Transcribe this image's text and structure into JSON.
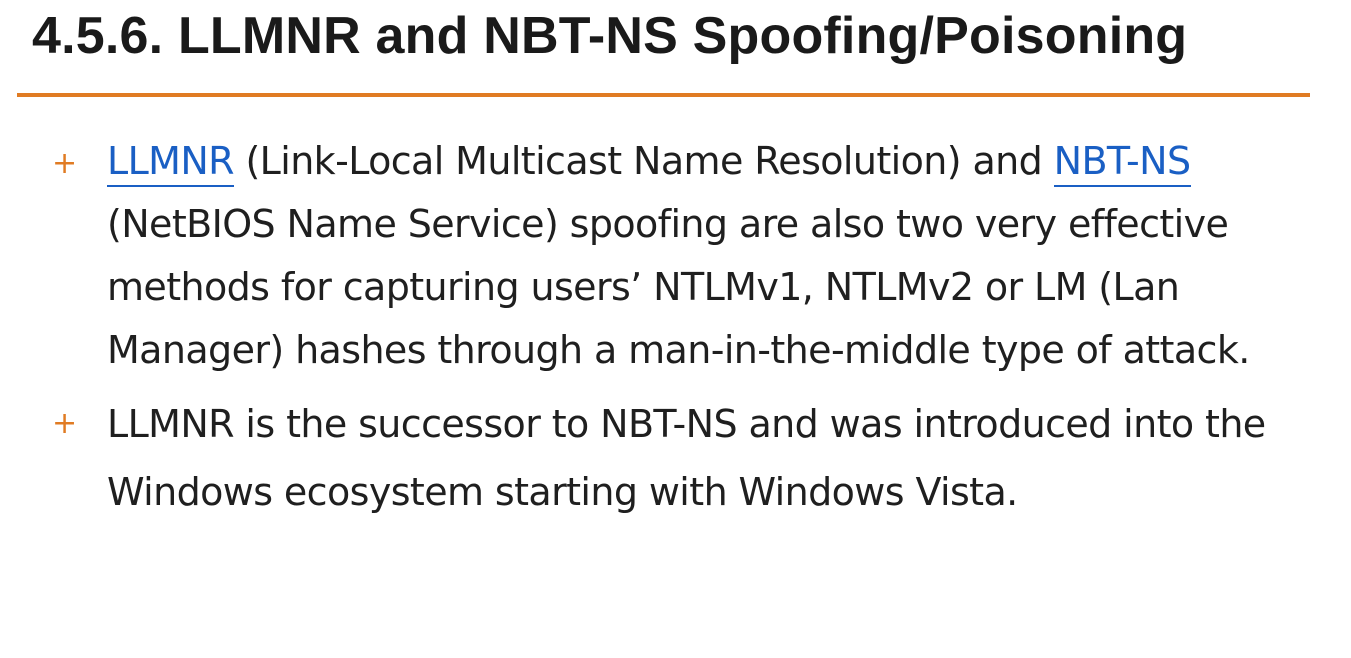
{
  "section": {
    "title": "4.5.6. LLMNR and NBT-NS Spoofing/Poisoning"
  },
  "bullets": [
    {
      "marker": "+",
      "link1": "LLMNR",
      "text1": " (Link-Local Multicast Name Resolution) and ",
      "link2": "NBT-NS",
      "text2": " (NetBIOS Name Service) spoofing are also two very effective methods for capturing users’ NTLMv1, NTLMv2 or LM (Lan Manager) hashes through a man-in-the-middle type of attack."
    },
    {
      "marker": "+",
      "text": "LLMNR is the successor to NBT-NS and was introduced into the Windows ecosystem starting with Windows Vista."
    }
  ],
  "colors": {
    "accent": "#e07b23",
    "link": "#1a5fc4",
    "text": "#1f1f1f"
  }
}
